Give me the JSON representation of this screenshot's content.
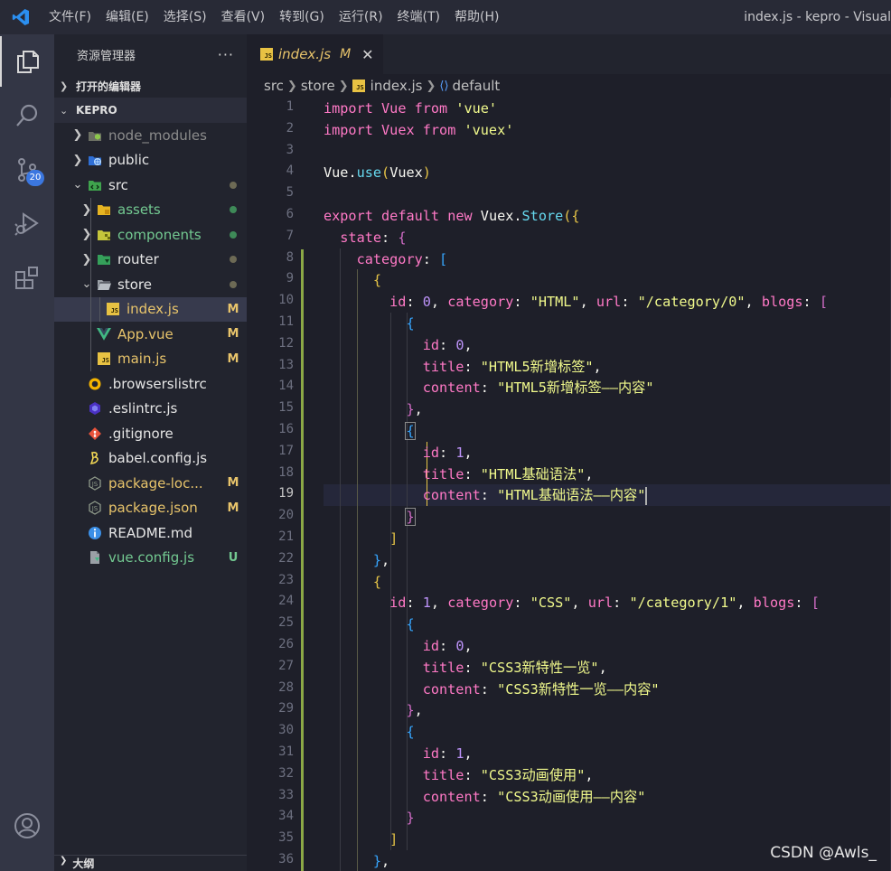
{
  "titlebar": {
    "menu": [
      "文件(F)",
      "编辑(E)",
      "选择(S)",
      "查看(V)",
      "转到(G)",
      "运行(R)",
      "终端(T)",
      "帮助(H)"
    ],
    "window_title": "index.js - kepro - Visual"
  },
  "activity": {
    "scm_badge": "20"
  },
  "sidebar": {
    "title": "资源管理器",
    "more": "···",
    "open_editors": "打开的编辑器",
    "project": "KEPRO",
    "outline": "大纲",
    "tree": [
      {
        "label": "node_modules",
        "icon": "node-folder-icon",
        "status": "",
        "dot": false,
        "color": "#8c8c8c"
      },
      {
        "label": "public",
        "icon": "globe-folder-icon",
        "status": "",
        "dot": false,
        "color": "#e6e6e6"
      },
      {
        "label": "src",
        "icon": "src-folder-icon",
        "status": "",
        "dot": true,
        "color": "#e6e6e6"
      },
      {
        "label": "assets",
        "icon": "assets-folder-icon",
        "status": "",
        "dot": true,
        "color": "#73c991"
      },
      {
        "label": "components",
        "icon": "components-folder-icon",
        "status": "",
        "dot": true,
        "color": "#73c991"
      },
      {
        "label": "router",
        "icon": "router-folder-icon",
        "status": "",
        "dot": true,
        "color": "#e6e6e6"
      },
      {
        "label": "store",
        "icon": "store-folder-icon",
        "status": "",
        "dot": true,
        "color": "#e6e6e6"
      },
      {
        "label": "index.js",
        "icon": "js-file-icon",
        "status": "M",
        "dot": false,
        "color": "#e8c46b"
      },
      {
        "label": "App.vue",
        "icon": "vue-file-icon",
        "status": "M",
        "dot": false,
        "color": "#e8c46b"
      },
      {
        "label": "main.js",
        "icon": "js-file-icon",
        "status": "M",
        "dot": false,
        "color": "#e8c46b"
      },
      {
        "label": ".browserslistrc",
        "icon": "browserslist-icon",
        "status": "",
        "dot": false,
        "color": "#e6e6e6"
      },
      {
        "label": ".eslintrc.js",
        "icon": "eslint-icon",
        "status": "",
        "dot": false,
        "color": "#e6e6e6"
      },
      {
        "label": ".gitignore",
        "icon": "git-icon",
        "status": "",
        "dot": false,
        "color": "#e6e6e6"
      },
      {
        "label": "babel.config.js",
        "icon": "babel-icon",
        "status": "",
        "dot": false,
        "color": "#e6e6e6"
      },
      {
        "label": "package-loc...",
        "icon": "npm-file-icon",
        "status": "M",
        "dot": false,
        "color": "#e8c46b"
      },
      {
        "label": "package.json",
        "icon": "npm-file-icon",
        "status": "M",
        "dot": false,
        "color": "#e8c46b"
      },
      {
        "label": "README.md",
        "icon": "info-icon",
        "status": "",
        "dot": false,
        "color": "#e6e6e6"
      },
      {
        "label": "vue.config.js",
        "icon": "config-file-icon",
        "status": "U",
        "dot": false,
        "color": "#73c991"
      }
    ]
  },
  "tab": {
    "name": "index.js",
    "modified": "M",
    "close": "✕"
  },
  "breadcrumb": [
    "src",
    "store",
    "index.js",
    "default"
  ],
  "editor": {
    "current_line": 19,
    "line_numbers": [
      "1",
      "2",
      "3",
      "4",
      "5",
      "6",
      "7",
      "8",
      "9",
      "10",
      "11",
      "12",
      "13",
      "14",
      "15",
      "16",
      "17",
      "18",
      "19",
      "20",
      "21",
      "22",
      "23",
      "24",
      "25",
      "26",
      "27",
      "28",
      "29",
      "30",
      "31",
      "32",
      "33",
      "34",
      "35",
      "36"
    ],
    "lines": [
      "import Vue from 'vue'",
      "import Vuex from 'vuex'",
      "",
      "Vue.use(Vuex)",
      "",
      "export default new Vuex.Store({",
      "  state: {",
      "    category: [",
      "      {",
      "        id: 0, category: \"HTML\", url: \"/category/0\", blogs: [",
      "          {",
      "            id: 0,",
      "            title: \"HTML5新增标签\",",
      "            content: \"HTML5新增标签——内容\"",
      "          },",
      "          {",
      "            id: 1,",
      "            title: \"HTML基础语法\",",
      "            content: \"HTML基础语法——内容\"",
      "          }",
      "        ]",
      "      },",
      "      {",
      "        id: 1, category: \"CSS\", url: \"/category/1\", blogs: [",
      "          {",
      "            id: 0,",
      "            title: \"CSS3新特性一览\",",
      "            content: \"CSS3新特性一览——内容\"",
      "          },",
      "          {",
      "            id: 1,",
      "            title: \"CSS3动画使用\",",
      "            content: \"CSS3动画使用——内容\"",
      "          }",
      "        ]",
      "      },"
    ]
  },
  "watermark": "CSDN @Awls_"
}
